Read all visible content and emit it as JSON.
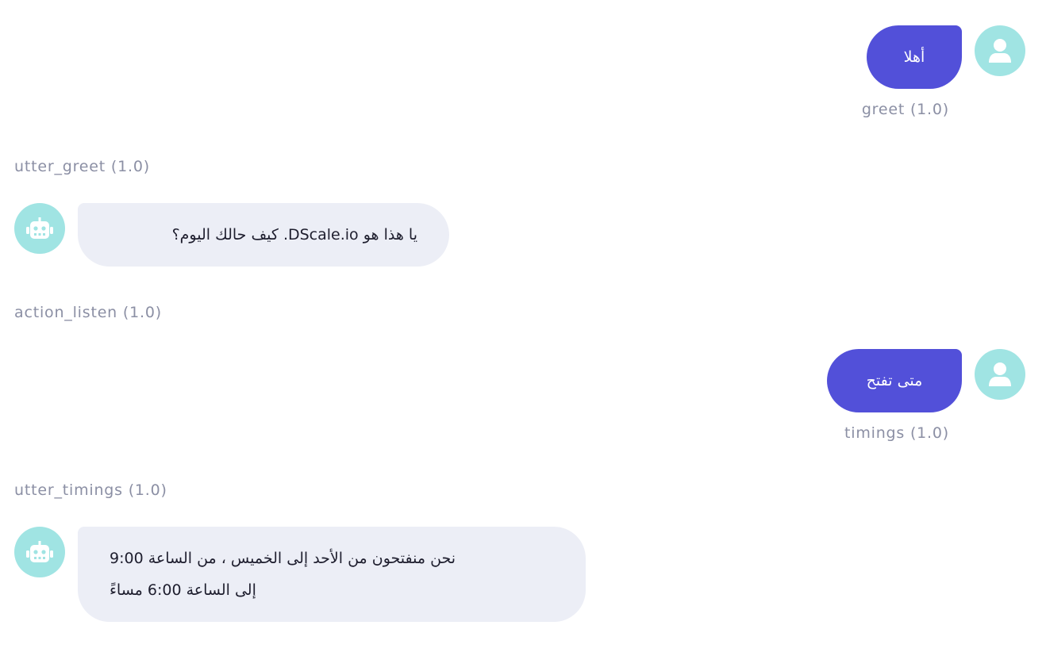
{
  "conversation": [
    {
      "sender": "user",
      "text": "أهلا",
      "intent": "greet",
      "confidence": "(1.0)",
      "avatar_icon": "user-icon"
    },
    {
      "sender": "bot",
      "action": "utter_greet",
      "confidence": "(1.0)",
      "text": "يا هذا هو DScale.io. كيف حالك اليوم؟",
      "avatar_icon": "robot-icon"
    },
    {
      "sender": "bot-action",
      "action": "action_listen",
      "confidence": "(1.0)"
    },
    {
      "sender": "user",
      "text": "متى تفتح",
      "intent": "timings",
      "confidence": "(1.0)",
      "avatar_icon": "user-icon"
    },
    {
      "sender": "bot",
      "action": "utter_timings",
      "confidence": "(1.0)",
      "text_line1": "نحن منفتحون من الأحد إلى الخميس ، من الساعة 9:00",
      "text_line2": "إلى الساعة 6:00 مساءً",
      "avatar_icon": "robot-icon"
    }
  ],
  "colors": {
    "user_bubble": "#5250d9",
    "bot_bubble": "#eceef6",
    "avatar_bg": "#a0e4e3",
    "meta_text": "#8b8fa4"
  }
}
